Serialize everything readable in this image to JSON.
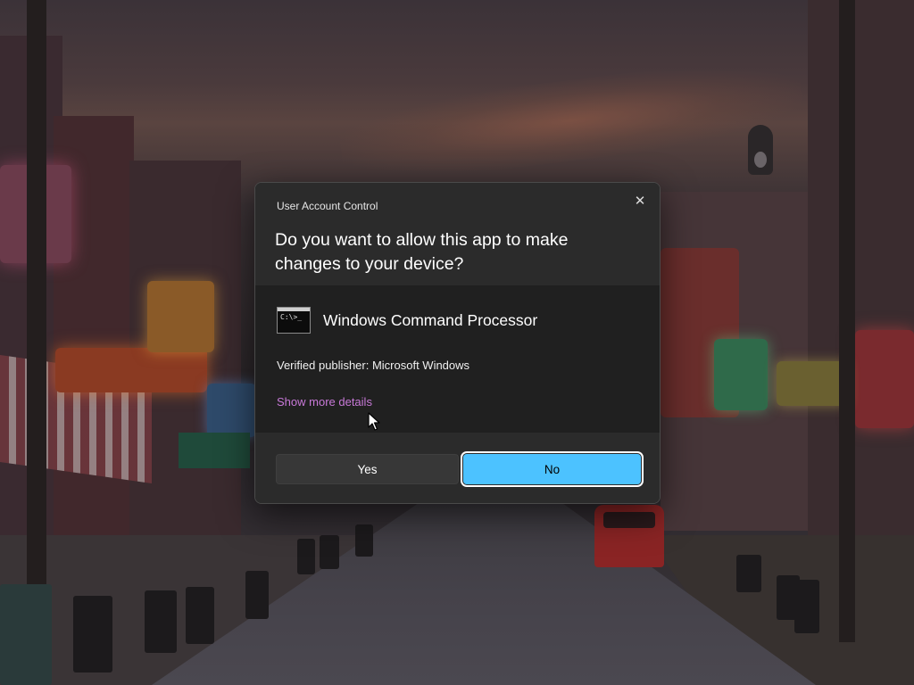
{
  "dialog": {
    "caption": "User Account Control",
    "question": "Do you want to allow this app to make changes to your device?",
    "app_name": "Windows Command Processor",
    "app_icon": "cmd-icon",
    "app_icon_prompt": "C:\\>_",
    "publisher": "Verified publisher: Microsoft Windows",
    "more_details": "Show more details",
    "close_glyph": "✕",
    "buttons": {
      "yes": "Yes",
      "no": "No"
    }
  },
  "colors": {
    "dialog_bg": "#2b2b2b",
    "body_bg": "#202020",
    "accent": "#4cc2ff",
    "link": "#c879d8"
  }
}
